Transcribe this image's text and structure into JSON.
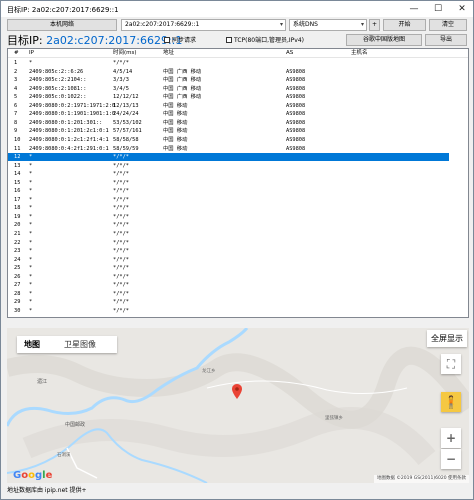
{
  "window": {
    "title": "目标IP: 2a02:c207:2017:6629::1",
    "controls": [
      "—",
      "☐",
      "✕"
    ]
  },
  "toolbar": {
    "local_network_label": "本机网络",
    "target_value": "2a02:c207:2017:6629::1",
    "dns_value": "系统DNS",
    "plus_label": "+",
    "start_label": "开始",
    "clear_label": "清空"
  },
  "header": {
    "target_prefix": "目标IP:",
    "target_ip": "2a02:c207:2017:6629::1",
    "sync_label": "同步请求",
    "tcp_label": "TCP(80端口,管理员,IPv4)",
    "map_button": "谷歌中国版地图",
    "export_button": "导出"
  },
  "table": {
    "columns": [
      "#",
      "IP",
      "时间(ms)",
      "地址",
      "AS",
      "主机名"
    ],
    "rows": [
      [
        "1",
        "*",
        "*/*/*",
        "",
        "",
        ""
      ],
      [
        "2",
        "2409:805c:2::6:26",
        "4/5/14",
        "中国 广西 移动",
        "AS9808",
        ""
      ],
      [
        "3",
        "2409:805c:2:2104::",
        "3/3/3",
        "中国 广西 移动",
        "AS9808",
        ""
      ],
      [
        "4",
        "2409:805c:2:1081::",
        "3/4/5",
        "中国 广西 移动",
        "AS9808",
        ""
      ],
      [
        "5",
        "2409:805c:0:1022::",
        "12/12/12",
        "中国 广西 移动",
        "AS9808",
        ""
      ],
      [
        "6",
        "2409:8080:0:2:1971:1971:2:0",
        "12/13/13",
        "中国 移动",
        "AS9808",
        ""
      ],
      [
        "7",
        "2409:8080:0:1:1901:1901:1:0",
        "24/24/24",
        "中国 移动",
        "AS9808",
        ""
      ],
      [
        "8",
        "2409:8080:0:1:201:301::",
        "53/53/102",
        "中国 移动",
        "AS9808",
        ""
      ],
      [
        "9",
        "2409:8080:0:1:201:2c1:0:1",
        "57/57/161",
        "中国 移动",
        "AS9808",
        ""
      ],
      [
        "10",
        "2409:8080:0:1:2c1:2f1:4:1",
        "58/58/58",
        "中国 移动",
        "AS9808",
        ""
      ],
      [
        "11",
        "2409:8080:0:4:2f1:291:0:1",
        "58/59/59",
        "中国 移动",
        "AS9808",
        ""
      ],
      [
        "12",
        "*",
        "*/*/*",
        "",
        "",
        ""
      ],
      [
        "13",
        "*",
        "*/*/*",
        "",
        "",
        ""
      ],
      [
        "14",
        "*",
        "*/*/*",
        "",
        "",
        ""
      ],
      [
        "15",
        "*",
        "*/*/*",
        "",
        "",
        ""
      ],
      [
        "16",
        "*",
        "*/*/*",
        "",
        "",
        ""
      ],
      [
        "17",
        "*",
        "*/*/*",
        "",
        "",
        ""
      ],
      [
        "18",
        "*",
        "*/*/*",
        "",
        "",
        ""
      ],
      [
        "19",
        "*",
        "*/*/*",
        "",
        "",
        ""
      ],
      [
        "20",
        "*",
        "*/*/*",
        "",
        "",
        ""
      ],
      [
        "21",
        "*",
        "*/*/*",
        "",
        "",
        ""
      ],
      [
        "22",
        "*",
        "*/*/*",
        "",
        "",
        ""
      ],
      [
        "23",
        "*",
        "*/*/*",
        "",
        "",
        ""
      ],
      [
        "24",
        "*",
        "*/*/*",
        "",
        "",
        ""
      ],
      [
        "25",
        "*",
        "*/*/*",
        "",
        "",
        ""
      ],
      [
        "26",
        "*",
        "*/*/*",
        "",
        "",
        ""
      ],
      [
        "27",
        "*",
        "*/*/*",
        "",
        "",
        ""
      ],
      [
        "28",
        "*",
        "*/*/*",
        "",
        "",
        ""
      ],
      [
        "29",
        "*",
        "*/*/*",
        "",
        "",
        ""
      ],
      [
        "30",
        "*",
        "*/*/*",
        "",
        "",
        ""
      ]
    ],
    "selected_row": "12"
  },
  "map": {
    "tab_map": "地图",
    "tab_satellite": "卫星图像",
    "fullscreen": "全屏显示",
    "google_logo": "Google",
    "footer": "地图数据 ©2019 GS(2011)6020  使用条款",
    "labels": [
      "湄江",
      "中国邮政",
      "龙江乡",
      "里弦镇乡",
      "石洞溪"
    ],
    "zoom_in": "+",
    "zoom_out": "−",
    "fullscreen_icon": "⛶",
    "pegman_icon": "🧍"
  },
  "status": {
    "text": "地址数据库由 ipip.net 提供+"
  }
}
